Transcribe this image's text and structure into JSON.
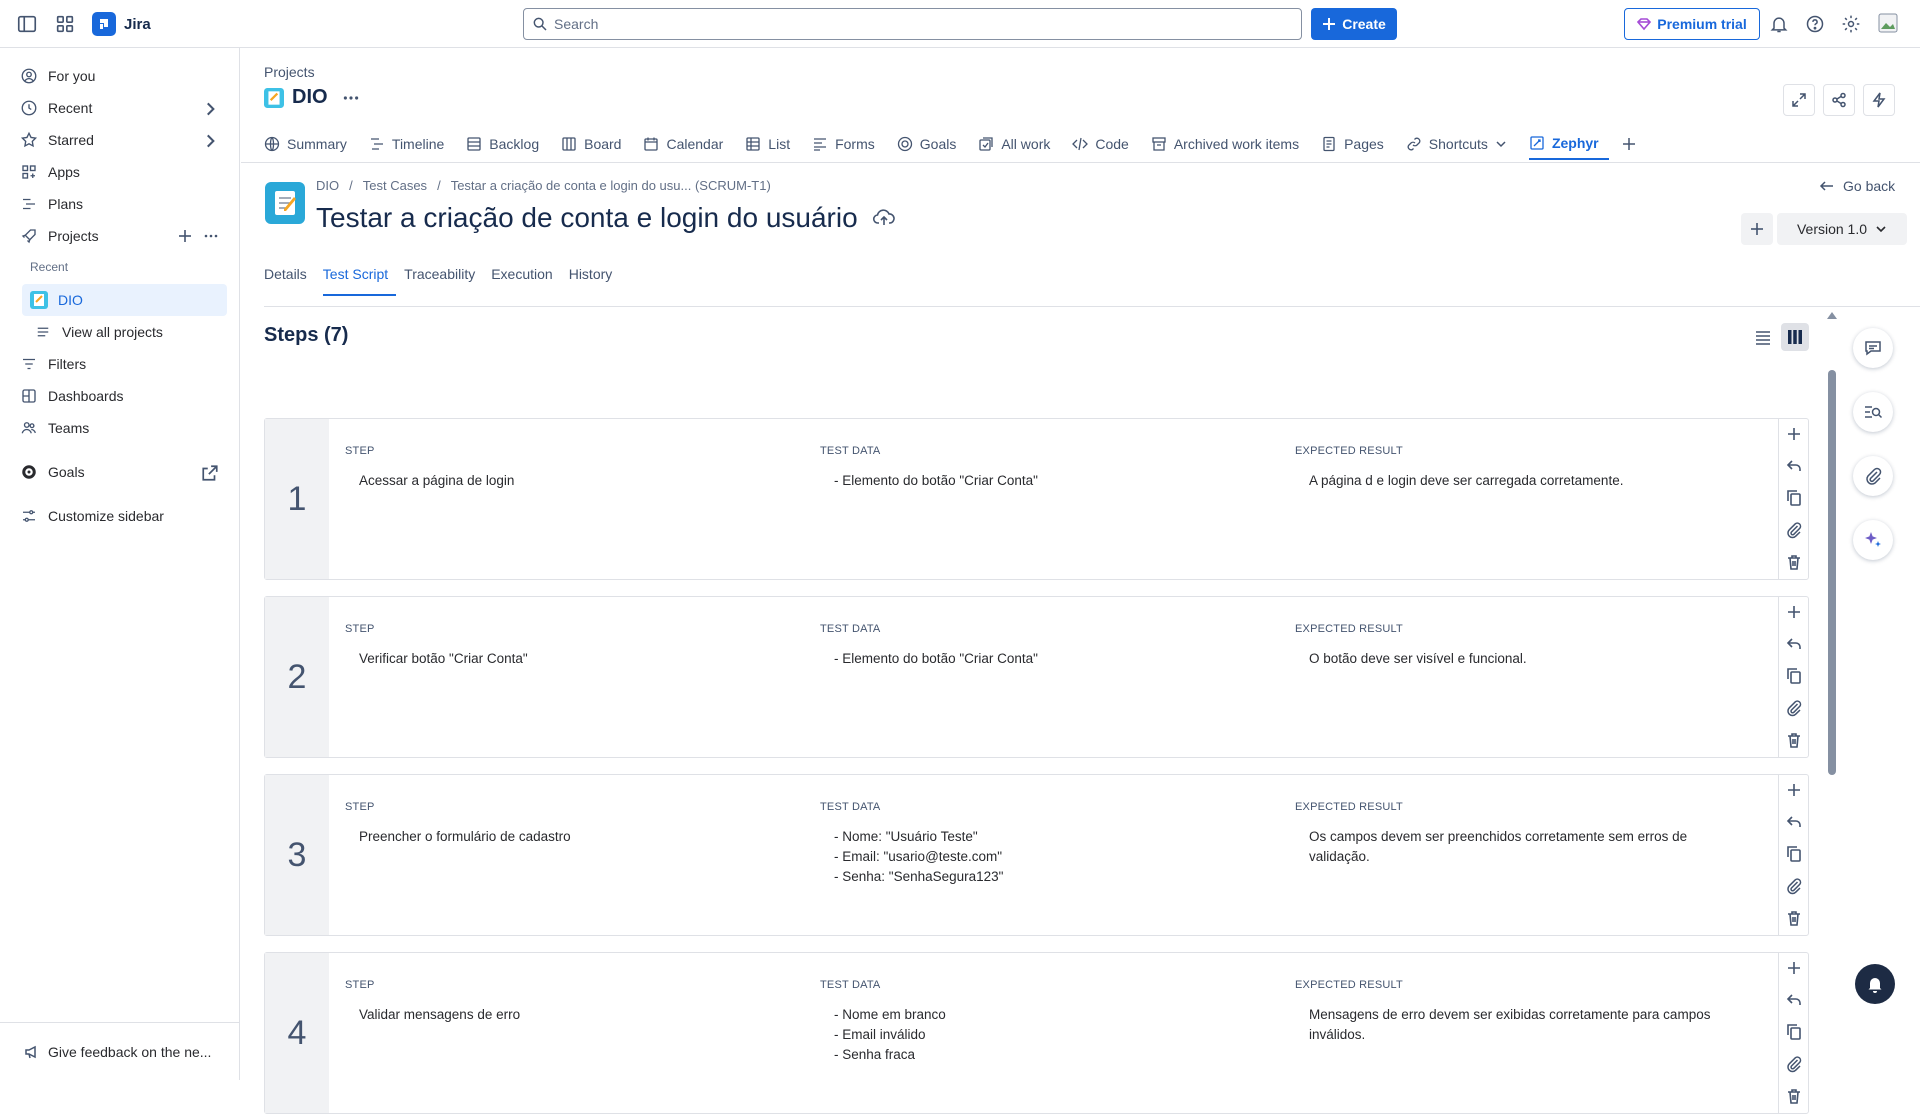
{
  "topbar": {
    "app_name": "Jira",
    "search_placeholder": "Search",
    "create_label": "Create",
    "premium_label": "Premium trial"
  },
  "sidebar": {
    "items": [
      {
        "label": "For you",
        "icon": "user-circle-icon"
      },
      {
        "label": "Recent",
        "icon": "clock-icon"
      },
      {
        "label": "Starred",
        "icon": "star-icon"
      },
      {
        "label": "Apps",
        "icon": "apps-icon"
      },
      {
        "label": "Plans",
        "icon": "plans-icon"
      },
      {
        "label": "Projects",
        "icon": "rocket-icon"
      }
    ],
    "recent_label": "Recent",
    "project_dio": "DIO",
    "view_all": "View all projects",
    "filters": "Filters",
    "dashboards": "Dashboards",
    "teams": "Teams",
    "goals": "Goals",
    "customize": "Customize sidebar",
    "feedback": "Give feedback on the ne..."
  },
  "header": {
    "projects_label": "Projects",
    "project_name": "DIO",
    "nav_tabs": [
      "Summary",
      "Timeline",
      "Backlog",
      "Board",
      "Calendar",
      "List",
      "Forms",
      "Goals",
      "All work",
      "Code",
      "Archived work items",
      "Pages",
      "Shortcuts",
      "Zephyr"
    ],
    "active_tab": "Zephyr"
  },
  "testcase": {
    "breadcrumb": [
      "DIO",
      "Test Cases",
      "Testar a criação de conta e login do usu... (SCRUM-T1)"
    ],
    "title": "Testar a criação de conta e login do usuário",
    "go_back": "Go back",
    "version": "Version 1.0",
    "tabs": [
      "Details",
      "Test Script",
      "Traceability",
      "Execution",
      "History"
    ],
    "active_tab": "Test Script",
    "steps_title": "Steps (7)",
    "col_step": "STEP",
    "col_data": "TEST DATA",
    "col_result": "EXPECTED RESULT"
  },
  "steps": [
    {
      "num": "1",
      "step": "Acessar a página de login",
      "data": [
        "- Elemento do botão \"Criar Conta\""
      ],
      "result": [
        "A página d e login deve ser carregada corretamente."
      ]
    },
    {
      "num": "2",
      "step": "Verificar botão \"Criar Conta\"",
      "data": [
        "- Elemento do botão \"Criar Conta\""
      ],
      "result": [
        "O botão deve ser visível e funcional."
      ]
    },
    {
      "num": "3",
      "step": "Preencher o formulário de cadastro",
      "data": [
        "- Nome: \"Usuário Teste\"",
        "- Email: \"usario@teste.com\"",
        "- Senha: \"SenhaSegura123\""
      ],
      "result": [
        "Os campos devem ser preenchidos corretamente sem erros de",
        "validação."
      ]
    },
    {
      "num": "4",
      "step": "Validar mensagens de erro",
      "data": [
        "- Nome em branco",
        "- Email inválido",
        "- Senha fraca"
      ],
      "result": [
        "Mensagens de erro devem ser exibidas corretamente para campos",
        "inválidos."
      ]
    }
  ],
  "colors": {
    "accent": "#1868db",
    "text": "#292a2e",
    "border": "#dfe1e6",
    "step_bg": "#f1f2f4"
  }
}
